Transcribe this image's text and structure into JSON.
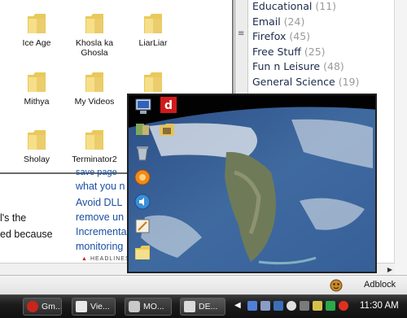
{
  "explorer": {
    "folders": [
      {
        "name": "Ice Age"
      },
      {
        "name": "Khosla ka Ghosla"
      },
      {
        "name": "LiarLiar"
      },
      {
        "name": "Mithya"
      },
      {
        "name": "My Videos"
      },
      {
        "name": "Sholay"
      },
      {
        "name": "Terminator2"
      }
    ]
  },
  "categories": [
    {
      "label": "Educational",
      "count": "(11)"
    },
    {
      "label": "Email",
      "count": "(24)"
    },
    {
      "label": "Firefox",
      "count": "(45)"
    },
    {
      "label": "Free Stuff",
      "count": "(25)"
    },
    {
      "label": "Fun n Leisure",
      "count": "(48)"
    },
    {
      "label": "General Science",
      "count": "(19)"
    }
  ],
  "webpage": {
    "links": [
      "save page",
      "what you n",
      "Avoid DLL",
      "remove un",
      "Incremental",
      "monitoring"
    ],
    "body_lines": [
      "l's the",
      "ed because"
    ],
    "headlines": "HEADLINES"
  },
  "statusbar": {
    "adblock_label": "Adblock"
  },
  "taskbar": {
    "buttons": [
      {
        "label": "Gm...",
        "icon": "gmail-icon"
      },
      {
        "label": "Vie...",
        "icon": "document-icon"
      },
      {
        "label": "MO...",
        "icon": "drive-icon"
      },
      {
        "label": "DE...",
        "icon": "window-icon"
      }
    ],
    "clock": "11:30 AM"
  },
  "colors": {
    "link": "#1a4fa0",
    "taskbar": "#1c1c1c",
    "category_text": "#1b2a4a",
    "count_text": "#9a9a9a"
  }
}
